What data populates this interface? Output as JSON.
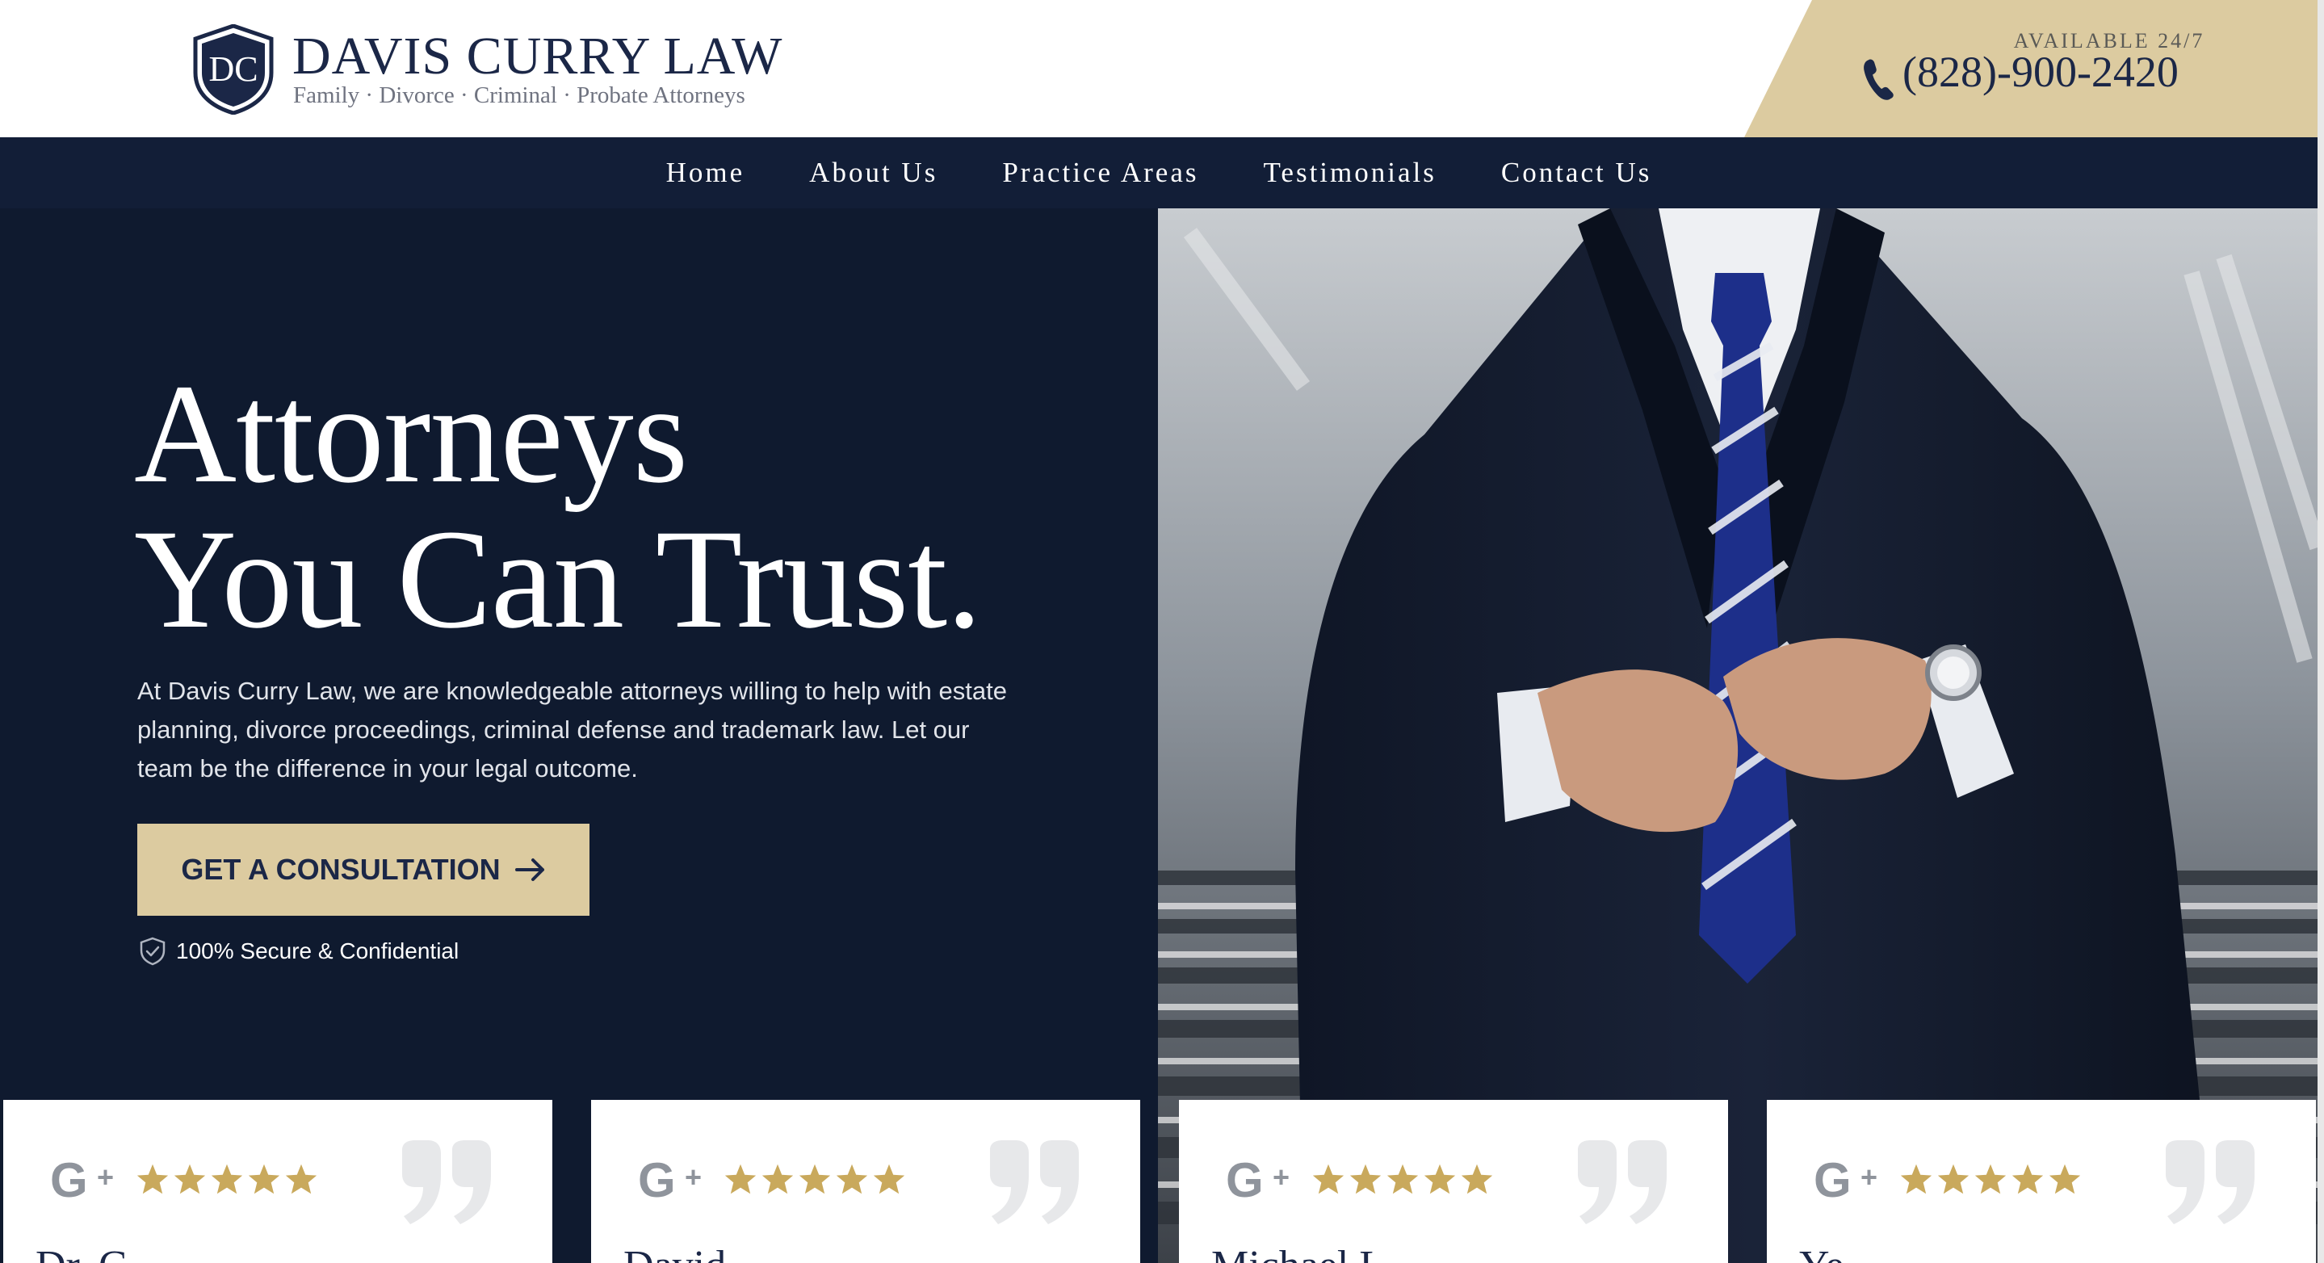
{
  "header": {
    "logo_monogram": "DC",
    "logo_title": "DAVIS CURRY LAW",
    "logo_subtitle": "Family · Divorce · Criminal · Probate Attorneys",
    "availability": "AVAILABLE 24/7",
    "phone": "(828)-900-2420",
    "phone_icon": "phone-icon"
  },
  "nav": {
    "items": [
      {
        "label": "Home"
      },
      {
        "label": "About Us"
      },
      {
        "label": "Practice Areas"
      },
      {
        "label": "Testimonials"
      },
      {
        "label": "Contact Us"
      }
    ]
  },
  "hero": {
    "title_line1": "Attorneys",
    "title_line2": "You Can Trust.",
    "description": "At Davis Curry Law, we are knowledgeable attorneys willing to help with estate planning, divorce proceedings, criminal defense and trademark law. Let our team be the difference in your legal outcome.",
    "cta_label": "GET A CONSULTATION",
    "secure_text": "100% Secure & Confidential",
    "photo_alt": "photo"
  },
  "reviews": [
    {
      "source": "G+",
      "rating": 5,
      "name_partial": "Dr. G..."
    },
    {
      "source": "G+",
      "rating": 5,
      "name_partial": "David..."
    },
    {
      "source": "G+",
      "rating": 5,
      "name_partial": "Michael L..."
    },
    {
      "source": "G+",
      "rating": 5,
      "name_partial": "Ye..."
    }
  ],
  "colors": {
    "navy": "#121e37",
    "hero_bg": "#0f1a2f",
    "gold": "#dccba0",
    "star": "#c9a95c",
    "text_dark": "#1b2747"
  }
}
